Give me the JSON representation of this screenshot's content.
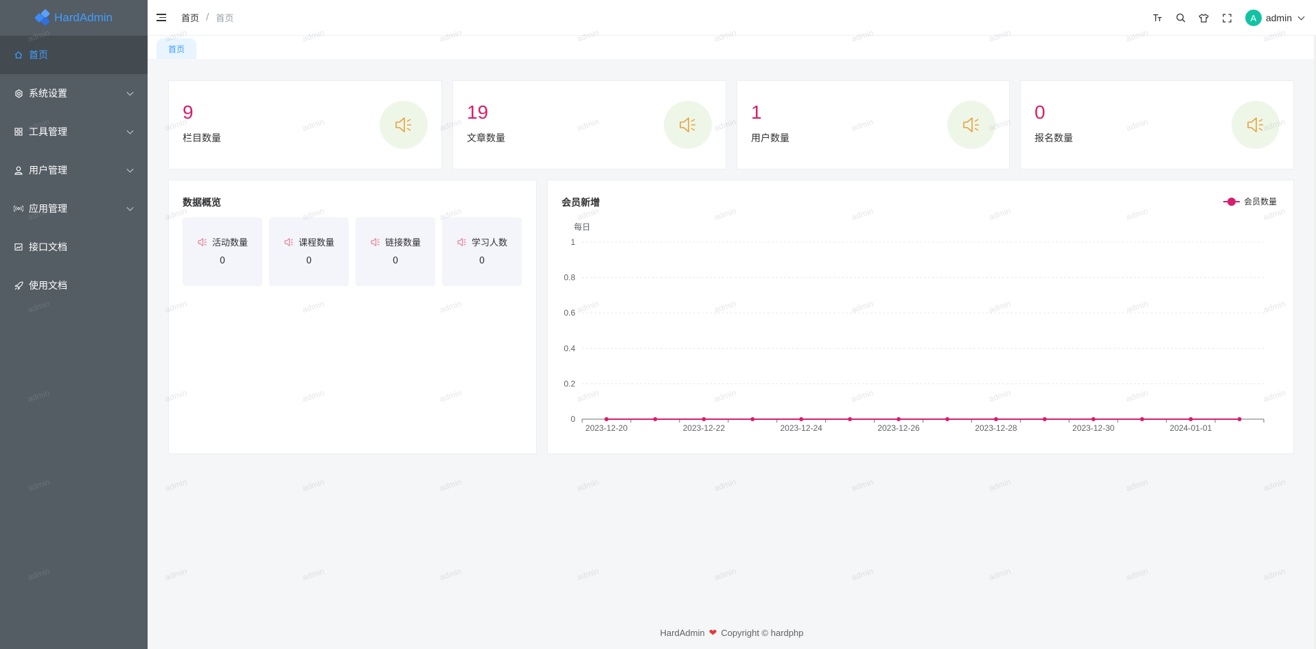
{
  "app": {
    "title": "HardAdmin"
  },
  "sidebar": {
    "items": [
      {
        "label": "首页",
        "icon": "home-icon",
        "active": true,
        "expandable": false
      },
      {
        "label": "系统设置",
        "icon": "gear-icon",
        "active": false,
        "expandable": true
      },
      {
        "label": "工具管理",
        "icon": "grid-icon",
        "active": false,
        "expandable": true
      },
      {
        "label": "用户管理",
        "icon": "user-icon",
        "active": false,
        "expandable": true
      },
      {
        "label": "应用管理",
        "icon": "broadcast-icon",
        "active": false,
        "expandable": true
      },
      {
        "label": "接口文档",
        "icon": "picture-icon",
        "active": false,
        "expandable": false
      },
      {
        "label": "使用文档",
        "icon": "rocket-icon",
        "active": false,
        "expandable": false
      }
    ]
  },
  "header": {
    "breadcrumb": [
      "首页",
      "首页"
    ],
    "separator": "/",
    "icons": [
      "font-size-icon",
      "search-icon",
      "theme-shirt-icon",
      "fullscreen-icon"
    ],
    "user": {
      "avatar_letter": "A",
      "name": "admin"
    }
  },
  "tabs": [
    {
      "label": "首页",
      "active": true
    }
  ],
  "stats": [
    {
      "value": "9",
      "label": "栏目数量"
    },
    {
      "value": "19",
      "label": "文章数量"
    },
    {
      "value": "1",
      "label": "用户数量"
    },
    {
      "value": "0",
      "label": "报名数量"
    }
  ],
  "overview": {
    "title": "数据概览",
    "items": [
      {
        "label": "活动数量",
        "value": "0"
      },
      {
        "label": "课程数量",
        "value": "0"
      },
      {
        "label": "链接数量",
        "value": "0"
      },
      {
        "label": "学习人数",
        "value": "0"
      }
    ]
  },
  "chart_panel": {
    "title": "会员新增"
  },
  "chart_data": {
    "type": "line",
    "title": "会员新增",
    "ylabel": "每日",
    "xlabel": "",
    "ylim": [
      0,
      1
    ],
    "yticks": [
      "0",
      "0.2",
      "0.4",
      "0.6",
      "0.8",
      "1"
    ],
    "x": [
      "2023-12-20",
      "2023-12-21",
      "2023-12-22",
      "2023-12-23",
      "2023-12-24",
      "2023-12-25",
      "2023-12-26",
      "2023-12-27",
      "2023-12-28",
      "2023-12-29",
      "2023-12-30",
      "2023-12-31",
      "2024-01-01",
      "2024-01-02"
    ],
    "xtick_labels": [
      "2023-12-20",
      "2023-12-22",
      "2023-12-24",
      "2023-12-26",
      "2023-12-28",
      "2023-12-30",
      "2024-01-01"
    ],
    "series": [
      {
        "name": "会员数量",
        "values": [
          0,
          0,
          0,
          0,
          0,
          0,
          0,
          0,
          0,
          0,
          0,
          0,
          0,
          0
        ],
        "color": "#d81e6d"
      }
    ],
    "legend": "top-right",
    "grid": true
  },
  "footer": {
    "brand": "HardAdmin",
    "copyright": "Copyright © hardphp"
  },
  "watermark": {
    "text": "admin"
  },
  "colors": {
    "accent": "#409eff",
    "number": "#d81e6d",
    "sidebar_bg": "#545c64",
    "badge_bg": "#eef6e8",
    "icon_orange": "#e6a23c"
  }
}
